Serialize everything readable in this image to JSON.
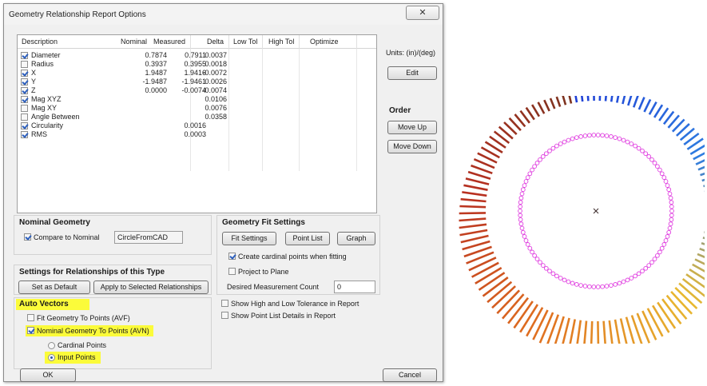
{
  "dialog": {
    "title": "Geometry Relationship Report Options",
    "close_glyph": "✕"
  },
  "table": {
    "headers": [
      "Description",
      "Nominal",
      "Measured",
      "Delta",
      "Low Tol",
      "High Tol",
      "Optimize"
    ],
    "rows": [
      {
        "checked": true,
        "description": "Diameter",
        "nominal": "0.7874",
        "measured": "0.7911",
        "delta": "0.0037"
      },
      {
        "checked": false,
        "description": "Radius",
        "nominal": "0.3937",
        "measured": "0.3955",
        "delta": "0.0018"
      },
      {
        "checked": true,
        "description": "X",
        "nominal": "1.9487",
        "measured": "1.9416",
        "delta": "-0.0072"
      },
      {
        "checked": true,
        "description": "Y",
        "nominal": "-1.9487",
        "measured": "-1.9461",
        "delta": "0.0026"
      },
      {
        "checked": true,
        "description": "Z",
        "nominal": "0.0000",
        "measured": "-0.0074",
        "delta": "-0.0074"
      },
      {
        "checked": true,
        "description": "Mag XYZ",
        "nominal": "",
        "measured": "",
        "delta": "0.0106"
      },
      {
        "checked": false,
        "description": "Mag XY",
        "nominal": "",
        "measured": "",
        "delta": "0.0076"
      },
      {
        "checked": false,
        "description": "Angle Between",
        "nominal": "",
        "measured": "",
        "delta": "0.0358"
      },
      {
        "checked": true,
        "description": "Circularity",
        "nominal": "",
        "measured": "0.0016",
        "delta": ""
      },
      {
        "checked": true,
        "description": "RMS",
        "nominal": "",
        "measured": "0.0003",
        "delta": ""
      }
    ]
  },
  "side": {
    "units_label": "Units: (in)/(deg)",
    "edit_label": "Edit",
    "order_label": "Order",
    "move_up_label": "Move Up",
    "move_down_label": "Move Down"
  },
  "nominal_geometry": {
    "title": "Nominal Geometry",
    "compare_label": "Compare to Nominal",
    "compare_checked": true,
    "nominal_name": "CircleFromCAD"
  },
  "settings_relationships": {
    "title": "Settings for Relationships of this Type",
    "set_default_label": "Set as Default",
    "apply_selected_label": "Apply to Selected Relationships"
  },
  "auto_vectors": {
    "title": "Auto Vectors",
    "fit_avf_label": "Fit Geometry To Points (AVF)",
    "fit_avf_checked": false,
    "nominal_avn_label": "Nominal Geometry To Points (AVN)",
    "nominal_avn_checked": true,
    "cardinal_points_label": "Cardinal Points",
    "input_points_label": "Input Points",
    "selected": "input_points"
  },
  "geometry_fit": {
    "title": "Geometry Fit Settings",
    "fit_settings_label": "Fit Settings",
    "point_list_label": "Point List",
    "graph_label": "Graph",
    "cardinal_points_label": "Create cardinal points when fitting",
    "cardinal_points_checked": true,
    "project_plane_label": "Project to Plane",
    "project_plane_checked": false,
    "desired_count_label": "Desired Measurement Count",
    "desired_count_value": "0"
  },
  "report_options": {
    "show_tol_label": "Show High and Low Tolerance in Report",
    "show_tol_checked": false,
    "show_points_label": "Show Point List Details in Report",
    "show_points_checked": false
  },
  "footer": {
    "ok_label": "OK",
    "cancel_label": "Cancel"
  },
  "plot_colors": {
    "circle": "#e040e0",
    "center": "#3a2a2a",
    "gradient": [
      "#1f3fd6",
      "#2f7de0",
      "#e8b830",
      "#e07020",
      "#b83020",
      "#7a3320"
    ]
  }
}
